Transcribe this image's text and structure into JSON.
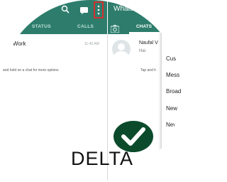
{
  "screen_left": {
    "tabs": [
      "STATUS",
      "CALLS"
    ],
    "chat": {
      "title": "Work",
      "time": "11:42 AM"
    },
    "hint": "and hold on a chat for more options"
  },
  "screen_right": {
    "app_title": "Whats",
    "active_tab": "CHATS",
    "contact": {
      "name": "Naufal V",
      "message": "Hai"
    },
    "hint": "Tap and h"
  },
  "menu": {
    "items": [
      "Cus",
      "Mess",
      "Broad",
      "New",
      "Nev"
    ]
  },
  "badge": {
    "label": "DELTA"
  },
  "colors": {
    "appbar": "#2e7d6c",
    "badge": "#0b4b2c",
    "highlight": "#d32f2f"
  },
  "icons": [
    "search-icon",
    "chat-icon",
    "more-vert-icon",
    "camera-icon",
    "check-icon",
    "avatar-icon"
  ]
}
